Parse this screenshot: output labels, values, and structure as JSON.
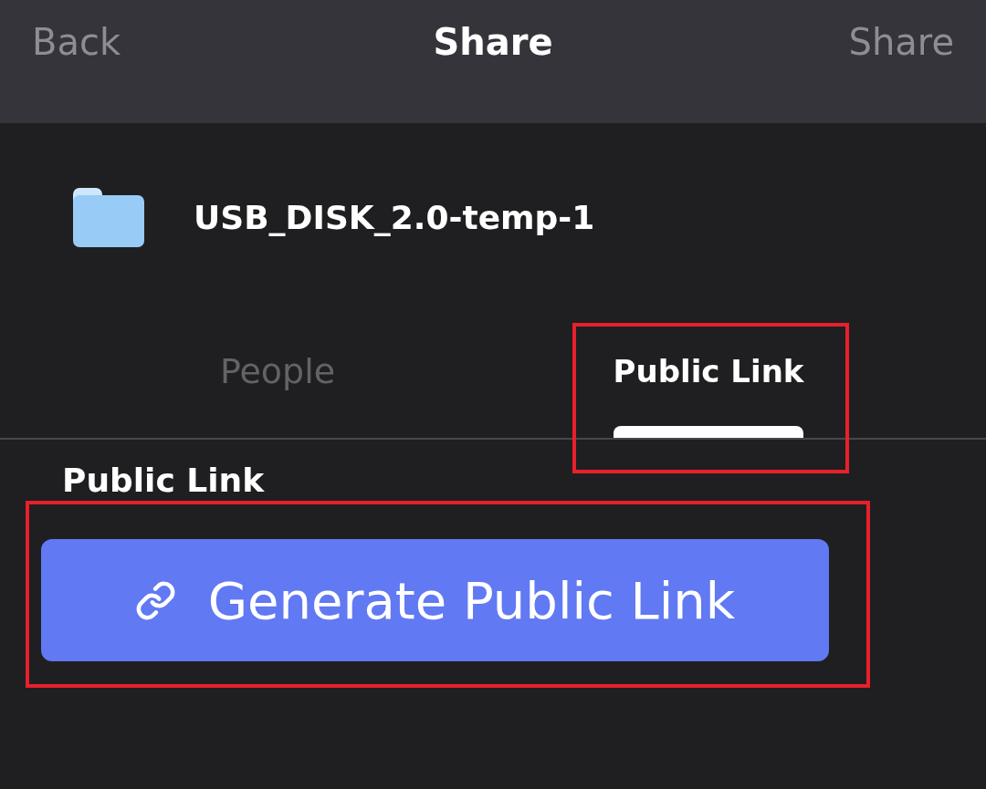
{
  "header": {
    "back": "Back",
    "title": "Share",
    "action": "Share"
  },
  "item": {
    "name": "USB_DISK_2.0-temp-1"
  },
  "tabs": [
    {
      "label": "People",
      "selected": false,
      "highlighted": false
    },
    {
      "label": "Public Link",
      "selected": true,
      "highlighted": true
    }
  ],
  "section": {
    "title": "Public Link"
  },
  "generate_button": {
    "label": "Generate Public Link",
    "highlighted": true
  }
}
